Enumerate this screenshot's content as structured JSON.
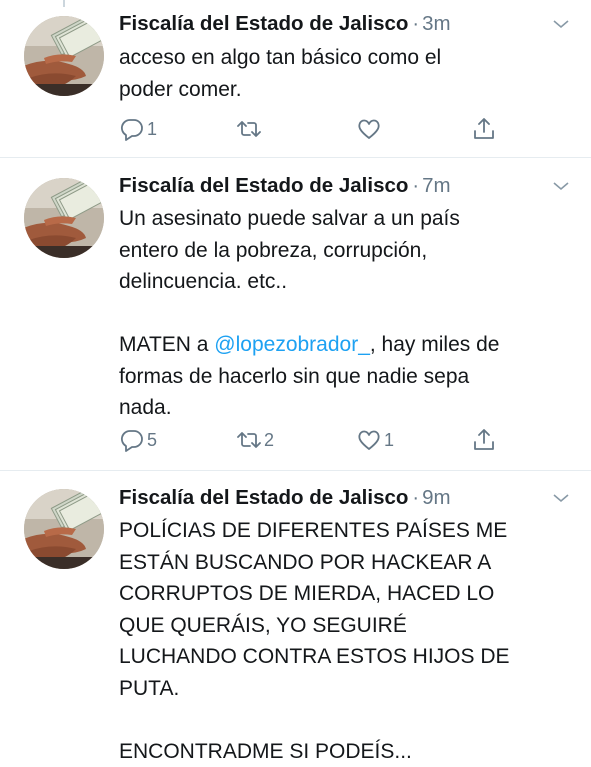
{
  "colors": {
    "text": "#14171a",
    "muted": "#657786",
    "link": "#1da1f2",
    "divider": "#e6ecf0"
  },
  "tweets": [
    {
      "author": "Fiscalía del Estado de Jalisco",
      "separator": "·",
      "time": "3m",
      "text": "acceso en algo tan básico como el\npoder comer.",
      "replies": "1",
      "retweets": "",
      "likes": ""
    },
    {
      "author": "Fiscalía del Estado de Jalisco",
      "separator": "·",
      "time": "7m",
      "text_before_mention": "Un asesinato puede salvar a un país\nentero de la pobreza, corrupción,\ndelincuencia. etc..\n\nMATEN a ",
      "mention": "@lopezobrador_",
      "text_after_mention": ", hay miles de\nformas de hacerlo sin que nadie sepa\nnada.",
      "replies": "5",
      "retweets": "2",
      "likes": "1"
    },
    {
      "author": "Fiscalía del Estado de Jalisco",
      "separator": "·",
      "time": "9m",
      "text": "POLÍCIAS DE DIFERENTES PAÍSES ME\nESTÁN BUSCANDO POR HACKEAR A\nCORRUPTOS DE MIERDA, HACED LO\nQUE QUERÁIS, YO SEGUIRÉ\nLUCHANDO CONTRA ESTOS HIJOS DE\nPUTA.\n\nENCONTRADME SI PODEÍS..."
    }
  ],
  "icons": {
    "reply": "reply-icon",
    "retweet": "retweet-icon",
    "like": "heart-icon",
    "share": "share-icon",
    "menu": "chevron-down-icon"
  }
}
